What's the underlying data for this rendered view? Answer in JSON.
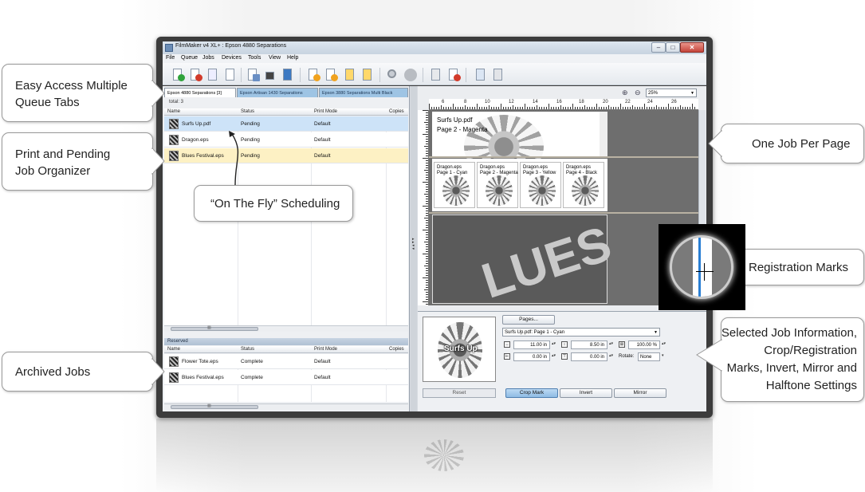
{
  "window": {
    "title": "FilmMaker v4 XL+ : Epson 4880 Separations",
    "controls": {
      "minimize": "–",
      "maximize": "□",
      "close": "✕"
    }
  },
  "menu": [
    "File",
    "Queue",
    "Jobs",
    "Devices",
    "Tools",
    "View",
    "Help"
  ],
  "toolbar_icons": [
    "add-job-icon",
    "delete-job-icon",
    "print-icon",
    "document-icon",
    "copy-icon",
    "printer-icon",
    "monitor-icon",
    "move-up-icon",
    "move-down-icon",
    "move-top-icon",
    "move-bottom-icon",
    "search-icon",
    "stop-icon",
    "resume-icon",
    "cancel-icon",
    "queue-icon",
    "queue-list-icon"
  ],
  "queue": {
    "tabs": [
      "Epson 4880 Separations [3]",
      "Epson Artisan 1430 Separations",
      "Epson 3880 Separations Multi Black"
    ],
    "total": "total: 3",
    "columns": [
      "Name",
      "Status",
      "Print Mode",
      "Copies"
    ],
    "rows": [
      {
        "name": "Surfs Up.pdf",
        "status": "Pending",
        "mode": "Default"
      },
      {
        "name": "Dragon.eps",
        "status": "Pending",
        "mode": "Default"
      },
      {
        "name": "Blues Festival.eps",
        "status": "Pending",
        "mode": "Default"
      }
    ],
    "scroll_grip": "▥"
  },
  "reserved": {
    "label": "Reserved",
    "columns": [
      "Name",
      "Status",
      "Print Mode",
      "Copies"
    ],
    "rows": [
      {
        "name": "Flower Tote.eps",
        "status": "Complete",
        "mode": "Default"
      },
      {
        "name": "Blues Festival.eps",
        "status": "Complete",
        "mode": "Default"
      }
    ],
    "scroll_grip": "▥"
  },
  "preview": {
    "zoom": "25%",
    "ruler_labels": [
      "6",
      "8",
      "10",
      "12",
      "14",
      "16",
      "18",
      "20",
      "22",
      "24",
      "26"
    ],
    "pages": [
      {
        "line1": "Surfs Up.pdf",
        "line2": "Page 2 - Magenta"
      }
    ],
    "dragon_pages": [
      {
        "line1": "Dragon.eps",
        "line2": "Page 1 - Cyan"
      },
      {
        "line1": "Dragon.eps",
        "line2": "Page 2 - Magenta"
      },
      {
        "line1": "Dragon.eps",
        "line2": "Page 3 - Yellow"
      },
      {
        "line1": "Dragon.eps",
        "line2": "Page 4 - Black"
      }
    ],
    "blues_text": "LUES"
  },
  "job_info": {
    "thumbnail_text": "Surfs Up",
    "pages_button": "Pages...",
    "job_select": "Surfs Up.pdf:   Page 1 - Cyan",
    "width": "11.00 in",
    "height": "8.50 in",
    "scale": "100.00 %",
    "offset_x": "0.00 in",
    "offset_y": "0.00 in",
    "rotate_label": "Rotate:",
    "rotate_value": "None",
    "reset_button": "Reset",
    "crop_button": "Crop Mark",
    "invert_button": "Invert",
    "mirror_button": "Mirror"
  },
  "callouts": {
    "queue_tabs": [
      "Easy Access Multiple",
      "Queue Tabs"
    ],
    "organizer": [
      "Print and Pending",
      "Job Organizer"
    ],
    "scheduling": "“On The Fly” Scheduling",
    "archived": "Archived Jobs",
    "one_job": "One Job Per Page",
    "registration": "Registration Marks",
    "selected": [
      "Selected Job Information,",
      "Crop/Registration",
      "Marks, Invert, Mirror and",
      "Halftone Settings"
    ]
  },
  "colors": {
    "accent_blue": "#9ec4e4",
    "selected_row": "#cde3f8",
    "pending_row": "#fdf1c4",
    "close_red": "#c4443a"
  }
}
